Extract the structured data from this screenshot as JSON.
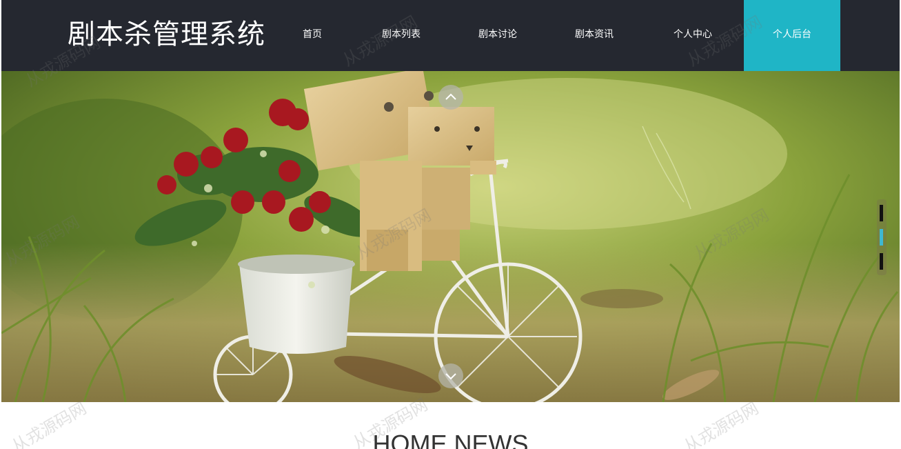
{
  "header": {
    "site_title": "剧本杀管理系统",
    "bg_color": "#252830",
    "active_color": "#1fb5c6"
  },
  "nav": {
    "items": [
      {
        "label": "首页",
        "active": false
      },
      {
        "label": "剧本列表",
        "active": false
      },
      {
        "label": "剧本讨论",
        "active": false
      },
      {
        "label": "剧本资讯",
        "active": false
      },
      {
        "label": "个人中心",
        "active": false
      },
      {
        "label": "个人后台",
        "active": true
      }
    ]
  },
  "banner": {
    "image": "cardboard-robot-on-bicycle-with-flowers",
    "prev_icon": "chevron-up-icon",
    "next_icon": "chevron-down-icon",
    "slide_count": 3,
    "active_slide": 2
  },
  "news": {
    "title": "HOME NEWS"
  },
  "watermark": {
    "text": "从戎源码网"
  }
}
